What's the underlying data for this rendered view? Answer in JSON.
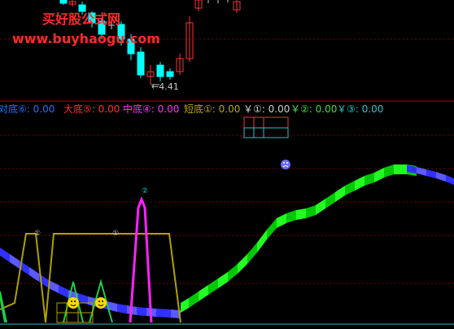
{
  "watermark": {
    "title": "买好股公式网",
    "url": "www.buyhaogu.com"
  },
  "price_panel": {
    "low_label": "4.41"
  },
  "legend": [
    {
      "label": "对底⑥: 0.00",
      "color": "#2b6bff"
    },
    {
      "label": "大底⑤: 0.00",
      "color": "#ff3030"
    },
    {
      "label": "中底④: 0.00",
      "color": "#ff33ff"
    },
    {
      "label": "短底①: 0.00",
      "color": "#b8a800"
    },
    {
      "label": "￥①: 0.00",
      "color": "#d0d0d0"
    },
    {
      "label": "￥②: 0.00",
      "color": "#44dd44"
    },
    {
      "label": "￥③: 0.00",
      "color": "#22c8c8"
    }
  ],
  "markers": {
    "m1": "①",
    "m2": "①",
    "m3": "②"
  },
  "colors": {
    "background": "#000000",
    "divider": "#b00000",
    "grid": "#7a0000",
    "bull": "#00ffff",
    "bear": "#ff3030",
    "blue_band": "#3a3aff",
    "green_band": "#22ff22",
    "magenta": "#ff22ff",
    "olive": "#b0a000",
    "green_line": "#22cc44"
  }
}
